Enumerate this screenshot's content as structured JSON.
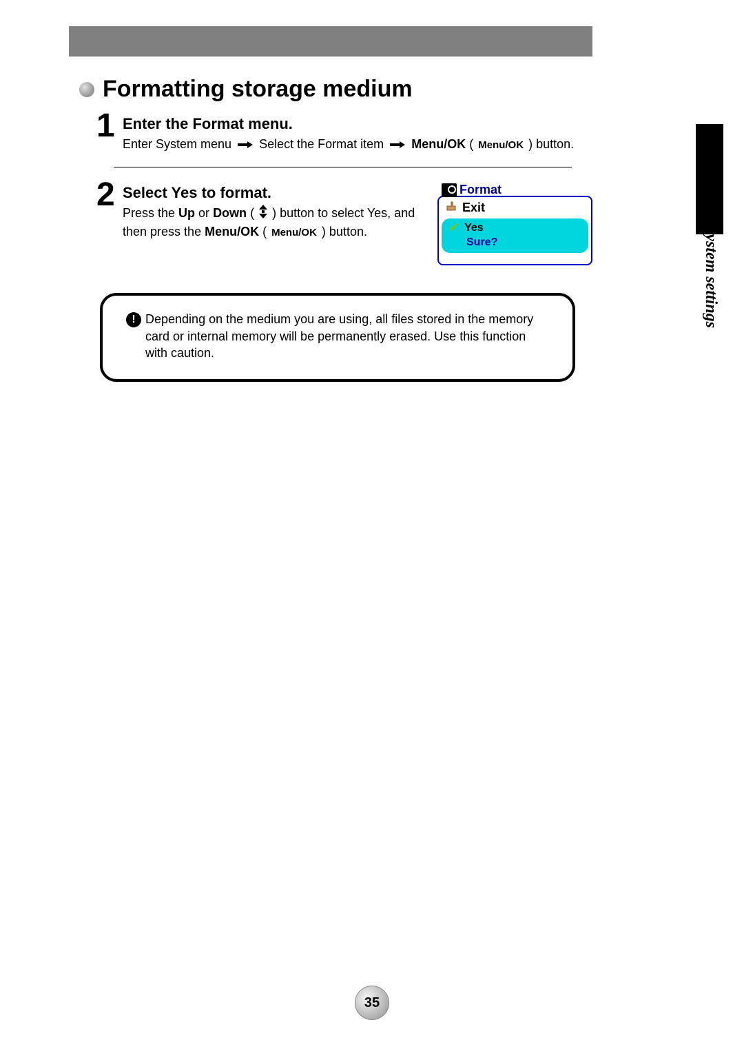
{
  "sideLabel": "system settings",
  "title": "Formatting storage medium",
  "step1": {
    "num": "1",
    "heading": "Enter the Format menu.",
    "text1": "Enter System menu",
    "text2": "Select the Format item",
    "menuOk": "Menu/OK",
    "menuOkBtn": "Menu/OK",
    "text3": "button."
  },
  "step2": {
    "num": "2",
    "heading": "Select Yes to format.",
    "press": "Press the ",
    "up": "Up",
    "or": " or ",
    "down": "Down",
    "lparen": " ( ",
    "rparen": " ) ",
    "toSelect": "button to select Yes, and then press the ",
    "menuOk": "Menu/OK",
    "menuOkBtn": "Menu/OK",
    "button": "button."
  },
  "menu": {
    "title": "Format",
    "exit": "Exit",
    "yes": "Yes",
    "sure": "Sure?"
  },
  "warning": "Depending on the medium you are using, all files stored in the memory card or internal memory will be permanently erased. Use this function with caution.",
  "pageNum": "35"
}
